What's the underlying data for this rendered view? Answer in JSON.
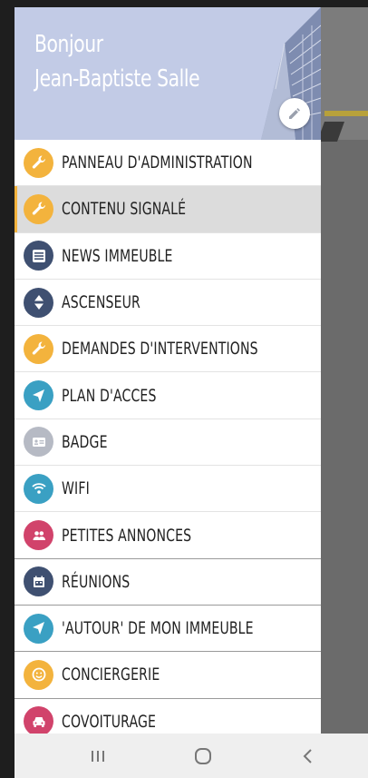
{
  "header": {
    "greeting_line1": "Bonjour",
    "greeting_line2": "Jean-Baptiste Salle",
    "background_color": "#c2cbe6"
  },
  "menu": {
    "items": [
      {
        "label": "PANNEAU D'ADMINISTRATION",
        "icon": "wrench-icon",
        "color": "#f3b33d"
      },
      {
        "label": "CONTENU SIGNALÉ",
        "icon": "wrench-icon",
        "color": "#f3b33d",
        "active": true
      },
      {
        "label": "NEWS IMMEUBLE",
        "icon": "news-icon",
        "color": "#3f5071"
      },
      {
        "label": "ASCENSEUR",
        "icon": "elevator-icon",
        "color": "#3f5071"
      },
      {
        "label": "DEMANDES D'INTERVENTIONS",
        "icon": "wrench-icon",
        "color": "#f3b33d"
      },
      {
        "label": "PLAN D'ACCES",
        "icon": "navigation-arrow-icon",
        "color": "#3aa0c3"
      },
      {
        "label": "BADGE",
        "icon": "badge-card-icon",
        "color": "#b6bac4"
      },
      {
        "label": "WIFI",
        "icon": "wifi-icon",
        "color": "#3aa0c3"
      },
      {
        "label": "PETITES ANNONCES",
        "icon": "people-icon",
        "color": "#d1436b"
      },
      {
        "label": "RÉUNIONS",
        "icon": "calendar-icon",
        "color": "#3f5071"
      },
      {
        "label": "'AUTOUR' DE MON IMMEUBLE",
        "icon": "navigation-arrow-icon",
        "color": "#3aa0c3"
      },
      {
        "label": "CONCIERGERIE",
        "icon": "smiley-icon",
        "color": "#f3b33d"
      },
      {
        "label": "COVOITURAGE",
        "icon": "car-icon",
        "color": "#d1436b"
      }
    ]
  },
  "navbar": {
    "recents": "recent-apps-icon",
    "home": "home-icon",
    "back": "back-icon"
  }
}
